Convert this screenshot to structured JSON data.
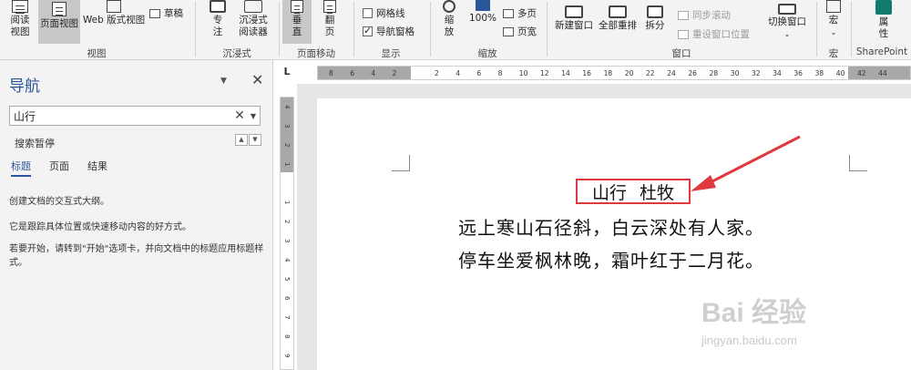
{
  "ribbon": {
    "buttons": {
      "read_mode": "阅读\n视图",
      "print_layout": "页面视图",
      "web_layout": "Web 版式视图",
      "draft": "草稿",
      "focus": "专\n注",
      "immersive_reader": "沉浸式\n阅读器",
      "vertical": "垂\n直",
      "side_to_side": "翻\n页",
      "gridlines": "网格线",
      "nav_pane": "导航窗格",
      "zoom": "缩\n放",
      "zoom_100": "100%",
      "multi_page": "多页",
      "page_width": "页宽",
      "new_window": "新建窗口",
      "arrange_all": "全部重排",
      "split": "拆分",
      "sync_scroll": "同步滚动",
      "reset_window": "重设窗口位置",
      "switch_window": "切换窗口",
      "macros": "宏",
      "properties": "属\n性"
    },
    "checkboxes": {
      "gridlines_checked": false,
      "nav_pane_checked": true
    },
    "groups": {
      "views": "视图",
      "immersive": "沉浸式",
      "page_movement": "页面移动",
      "show": "显示",
      "zoom": "缩放",
      "window": "窗口",
      "macros": "宏",
      "sharepoint": "SharePoint"
    }
  },
  "nav": {
    "title": "导航",
    "search_value": "山行",
    "status": "搜索暂停",
    "tabs": [
      "标题",
      "页面",
      "结果"
    ],
    "selected_tab": 0,
    "help1": "创建文档的交互式大纲。",
    "help2": "它是跟踪具体位置或快速移动内容的好方式。",
    "help3": "若要开始，请转到\"开始\"选项卡，并向文档中的标题应用标题样式。"
  },
  "ruler": {
    "corner": "L",
    "h_ticks": [
      "8",
      "6",
      "4",
      "2",
      "",
      "2",
      "4",
      "6",
      "8",
      "10",
      "12",
      "14",
      "16",
      "18",
      "20",
      "22",
      "24",
      "26",
      "28",
      "30",
      "32",
      "34",
      "36",
      "38",
      "40",
      "42",
      "44"
    ],
    "v_ticks": [
      "4",
      "3",
      "2",
      "1",
      "",
      "1",
      "2",
      "3",
      "4",
      "5",
      "6",
      "7",
      "8",
      "9"
    ]
  },
  "document": {
    "title_part1": "山行",
    "title_part2": "杜牧",
    "line1": "远上寒山石径斜，白云深处有人家。",
    "line2": "停车坐爱枫林晚，霜叶红于二月花。"
  },
  "watermark": {
    "main": "Bai  经验",
    "sub": "jingyan.baidu.com"
  },
  "colors": {
    "accent": "#2b579a",
    "highlight_box": "#e0393e",
    "arrow": "#e0393e"
  }
}
